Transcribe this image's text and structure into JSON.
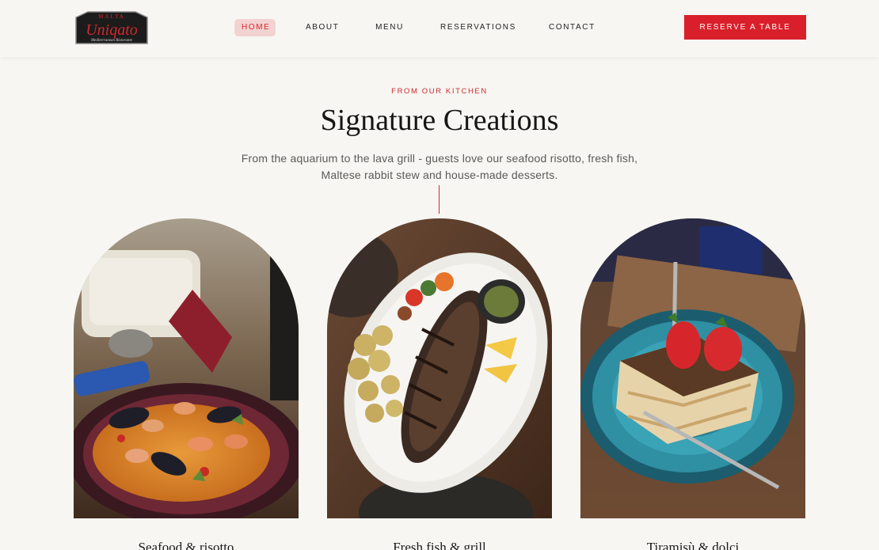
{
  "brand": {
    "name": "Uniqato",
    "top_text": "MALTA",
    "tagline": "Mediterranean Ristorante"
  },
  "nav": {
    "items": [
      {
        "label": "HOME",
        "active": true
      },
      {
        "label": "ABOUT",
        "active": false
      },
      {
        "label": "MENU",
        "active": false
      },
      {
        "label": "RESERVATIONS",
        "active": false
      },
      {
        "label": "CONTACT",
        "active": false
      }
    ],
    "cta_label": "RESERVE A TABLE"
  },
  "section": {
    "eyebrow": "FROM OUR KITCHEN",
    "title": "Signature Creations",
    "description": "From the aquarium to the lava grill - guests love our seafood risotto, fresh fish, Maltese rabbit stew and house-made desserts."
  },
  "cards": [
    {
      "caption": "Seafood & risotto"
    },
    {
      "caption": "Fresh fish & grill"
    },
    {
      "caption": "Tiramisù & dolci"
    }
  ],
  "colors": {
    "accent": "#d91f2a",
    "background": "#f7f6f2",
    "active_nav_bg": "#f3d2d2"
  }
}
